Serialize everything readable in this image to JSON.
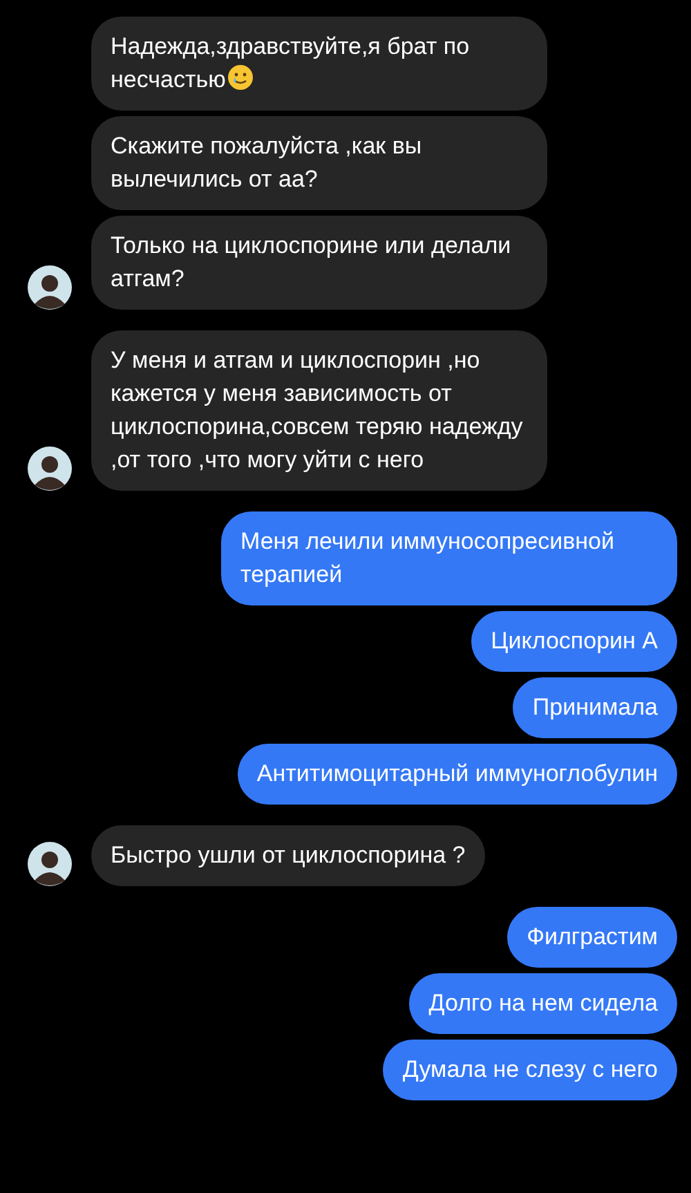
{
  "groups": [
    {
      "kind": "incoming",
      "messages": [
        {
          "kind": "text_emoji",
          "text": "Надежда,здравствуйте,я брат по несчастью"
        },
        {
          "kind": "text",
          "text": "Скажите пожалуйста ,как вы вылечились от аа?"
        },
        {
          "kind": "text",
          "text": "Только на циклоспорине или делали атгам?"
        }
      ]
    },
    {
      "kind": "incoming",
      "messages": [
        {
          "kind": "text",
          "text": "У меня и атгам и циклоспорин ,но кажется у меня зависимость от циклоспорина,совсем теряю надежду ,от того ,что могу уйти с него"
        }
      ]
    },
    {
      "kind": "outgoing",
      "messages": [
        {
          "kind": "text",
          "text": "Меня лечили иммуносопресивной терапией"
        },
        {
          "kind": "text",
          "text": "Циклоспорин А"
        },
        {
          "kind": "text",
          "text": "Принимала"
        },
        {
          "kind": "text",
          "text": "Антитимоцитарный иммуноглобулин"
        }
      ]
    },
    {
      "kind": "incoming",
      "messages": [
        {
          "kind": "text",
          "text": "Быстро ушли от циклоспорина ?"
        }
      ]
    },
    {
      "kind": "outgoing",
      "messages": [
        {
          "kind": "text",
          "text": "Филграстим"
        },
        {
          "kind": "text",
          "text": "Долго на нем сидела"
        },
        {
          "kind": "text",
          "text": "Думала не слезу с него"
        }
      ]
    }
  ]
}
